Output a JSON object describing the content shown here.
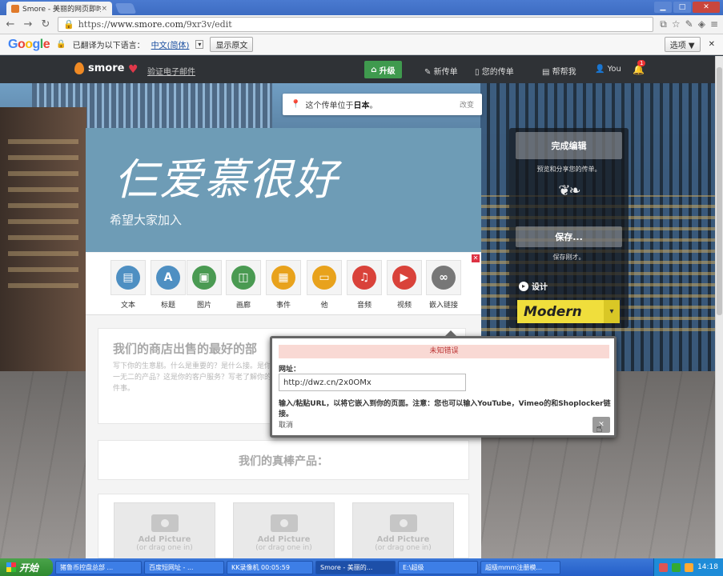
{
  "browser": {
    "tab_title": "Smore - 美丽的网页即时",
    "tab_close": "×",
    "url_scheme": "https://",
    "url_host": "www.smore.com",
    "url_path": "/9xr3v/edit",
    "window_controls": [
      "▁",
      "□",
      "✕"
    ]
  },
  "translate_bar": {
    "logo": [
      "G",
      "o",
      "o",
      "g",
      "l",
      "e"
    ],
    "prefix": "已翻译为以下语言：",
    "language": "中文(简体)",
    "show_original": "显示原文",
    "options": "选项 ▼",
    "close": "✕"
  },
  "site_header": {
    "brand": "smore",
    "verify_email": "验证电子邮件",
    "upgrade": "升级",
    "new_flyer": "新传单",
    "my_flyers": "您的传单",
    "help": "帮帮我",
    "user": "You",
    "notifications": "1"
  },
  "location_tip": {
    "text_before": "这个传单位于",
    "country": "日本",
    "text_after": "。",
    "change": "改变"
  },
  "flyer": {
    "title": "仨爱慕很好",
    "subtitle": "希望大家加入",
    "blocks": [
      {
        "label": "文本",
        "glyph": "▤",
        "color": "#4e8fc2"
      },
      {
        "label": "标题",
        "glyph": "A",
        "color": "#4e8fc2"
      },
      {
        "label": "图片",
        "glyph": "▣",
        "color": "#4a9a52"
      },
      {
        "label": "画廊",
        "glyph": "◫",
        "color": "#4a9a52"
      },
      {
        "label": "事件",
        "glyph": "▦",
        "color": "#e8a21c"
      },
      {
        "label": "他",
        "glyph": "▭",
        "color": "#e8a21c"
      },
      {
        "label": "音频",
        "glyph": "♫",
        "color": "#d9423a"
      },
      {
        "label": "视频",
        "glyph": "▶",
        "color": "#d9423a"
      },
      {
        "label": "嵌入链接",
        "glyph": "∞",
        "color": "#777777"
      }
    ],
    "section1_heading": "我们的商店出售的最好的部",
    "section1_body": "写下你的生意剧。什么是重要的？是什么接。是你独一无二的产品？这是你的客户服务？写老了解你的一件事。",
    "section2_heading": "我们的真棒产品：",
    "pictures": [
      {
        "title": "Add Picture",
        "sub": "(or drag one in)"
      },
      {
        "title": "Add Picture",
        "sub": "(or drag one in)"
      },
      {
        "title": "Add Picture",
        "sub": "(or drag one in)"
      }
    ]
  },
  "side_panel": {
    "finish": "完成编辑",
    "finish_note": "预览和分享您的传单。",
    "save": "保存...",
    "save_note": "保存刚才。",
    "design": "设计",
    "theme": "Modern"
  },
  "embed_dialog": {
    "error": "未知错误",
    "url_label": "网址：",
    "url_value": "http://dwz.cn/2x0OMx",
    "hint": "输入/粘贴URL，以将它嵌入到你的页面。注意：您也可以输入YouTube，Vimeo的和Shoplocker链接。",
    "cancel": "取消",
    "ok": "✕"
  },
  "taskbar": {
    "start": "开始",
    "tasks": [
      "猪鲁币控盘总部 ...",
      "百度短网址 - ...",
      "KK录像机 00:05:59",
      "Smore - 美丽的...",
      "E:\\超级",
      "超级mmm注册模..."
    ],
    "clock": "14:18"
  }
}
